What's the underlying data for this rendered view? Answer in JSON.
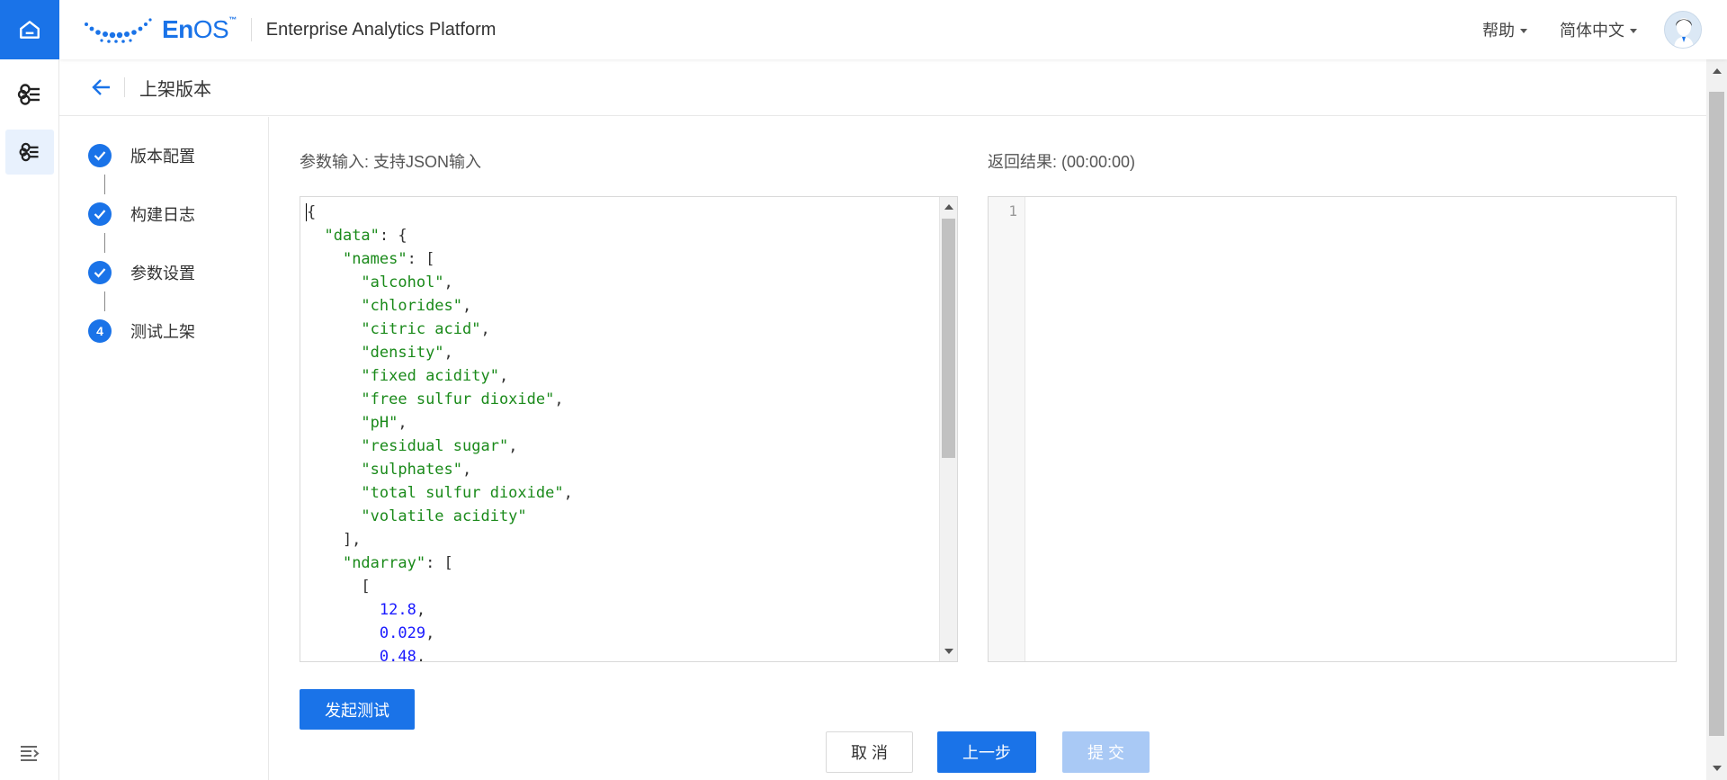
{
  "rail": {
    "items": [
      "home-icon",
      "model-icon",
      "model-icon"
    ],
    "bottom_icon": "menu-collapse-icon"
  },
  "header": {
    "logo_en": "En",
    "logo_os": "OS",
    "logo_tm": "™",
    "app_title": "Enterprise Analytics Platform",
    "help_label": "帮助",
    "language_label": "简体中文"
  },
  "page": {
    "title": "上架版本"
  },
  "steps": [
    {
      "label": "版本配置",
      "status": "done"
    },
    {
      "label": "构建日志",
      "status": "done"
    },
    {
      "label": "参数设置",
      "status": "done"
    },
    {
      "label": "测试上架",
      "status": "current",
      "number": "4"
    }
  ],
  "input": {
    "label": "参数输入: 支持JSON输入",
    "json_lines": [
      "{",
      "  \"data\": {",
      "    \"names\": [",
      "      \"alcohol\",",
      "      \"chlorides\",",
      "      \"citric acid\",",
      "      \"density\",",
      "      \"fixed acidity\",",
      "      \"free sulfur dioxide\",",
      "      \"pH\",",
      "      \"residual sugar\",",
      "      \"sulphates\",",
      "      \"total sulfur dioxide\",",
      "      \"volatile acidity\"",
      "    ],",
      "    \"ndarray\": [",
      "      [",
      "        12.8,",
      "        0.029,",
      "        0.48,"
    ]
  },
  "result": {
    "label": "返回结果: (00:00:00)",
    "line_number": "1"
  },
  "buttons": {
    "run_test": "发起测试",
    "cancel": "取 消",
    "prev": "上一步",
    "submit": "提 交"
  },
  "colors": {
    "primary": "#1a73e8",
    "string": "#1a8a1a",
    "number": "#1a1aff"
  }
}
